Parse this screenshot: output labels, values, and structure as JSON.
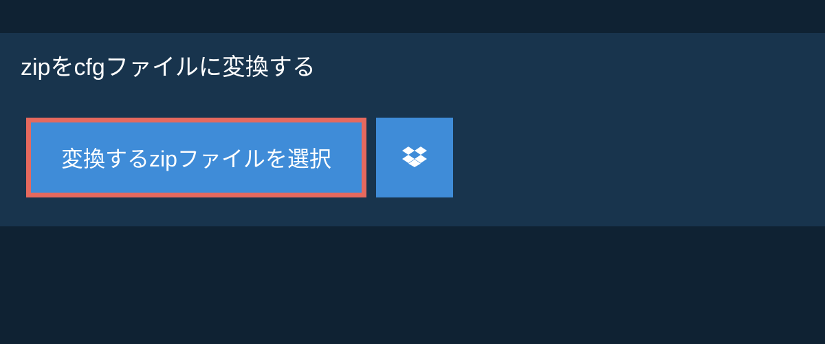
{
  "header": {
    "title": "zipをcfgファイルに変換する"
  },
  "actions": {
    "select_file_label": "変換するzipファイルを選択",
    "dropbox_icon": "dropbox-icon"
  },
  "colors": {
    "background": "#0f2233",
    "panel": "#18344d",
    "button": "#3f8cd8",
    "highlight_border": "#e6695e"
  }
}
